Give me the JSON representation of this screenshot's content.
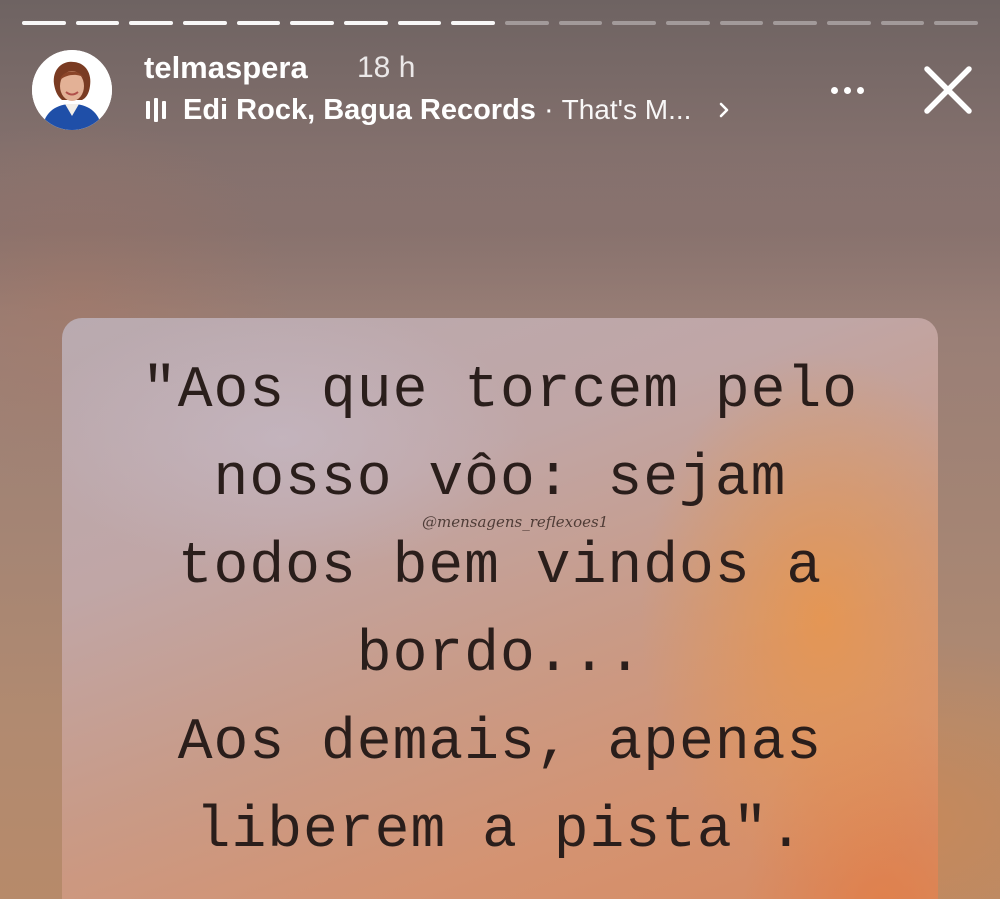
{
  "progress": {
    "total_segments": 18,
    "completed_segments": 9
  },
  "header": {
    "username": "telmaspera",
    "time": "18 h",
    "music": {
      "icon": "music-bars-icon",
      "artist": "Edi Rock, Bagua Records",
      "separator": "·",
      "song": "That's M..."
    },
    "more_icon": "more-dots-icon",
    "close_icon": "close-icon"
  },
  "post": {
    "watermark": "@mensagens_reflexoes1",
    "quote_lines": [
      "\"Aos que torcem pelo",
      "nosso vôo: sejam",
      "todos bem vindos a",
      "bordo...",
      "Aos demais, apenas",
      "liberem a pista\"."
    ]
  },
  "colors": {
    "text_on_story": "#ffffff",
    "quote_text": "#2a1e1b",
    "avatar_jacket": "#1f4fa8"
  }
}
